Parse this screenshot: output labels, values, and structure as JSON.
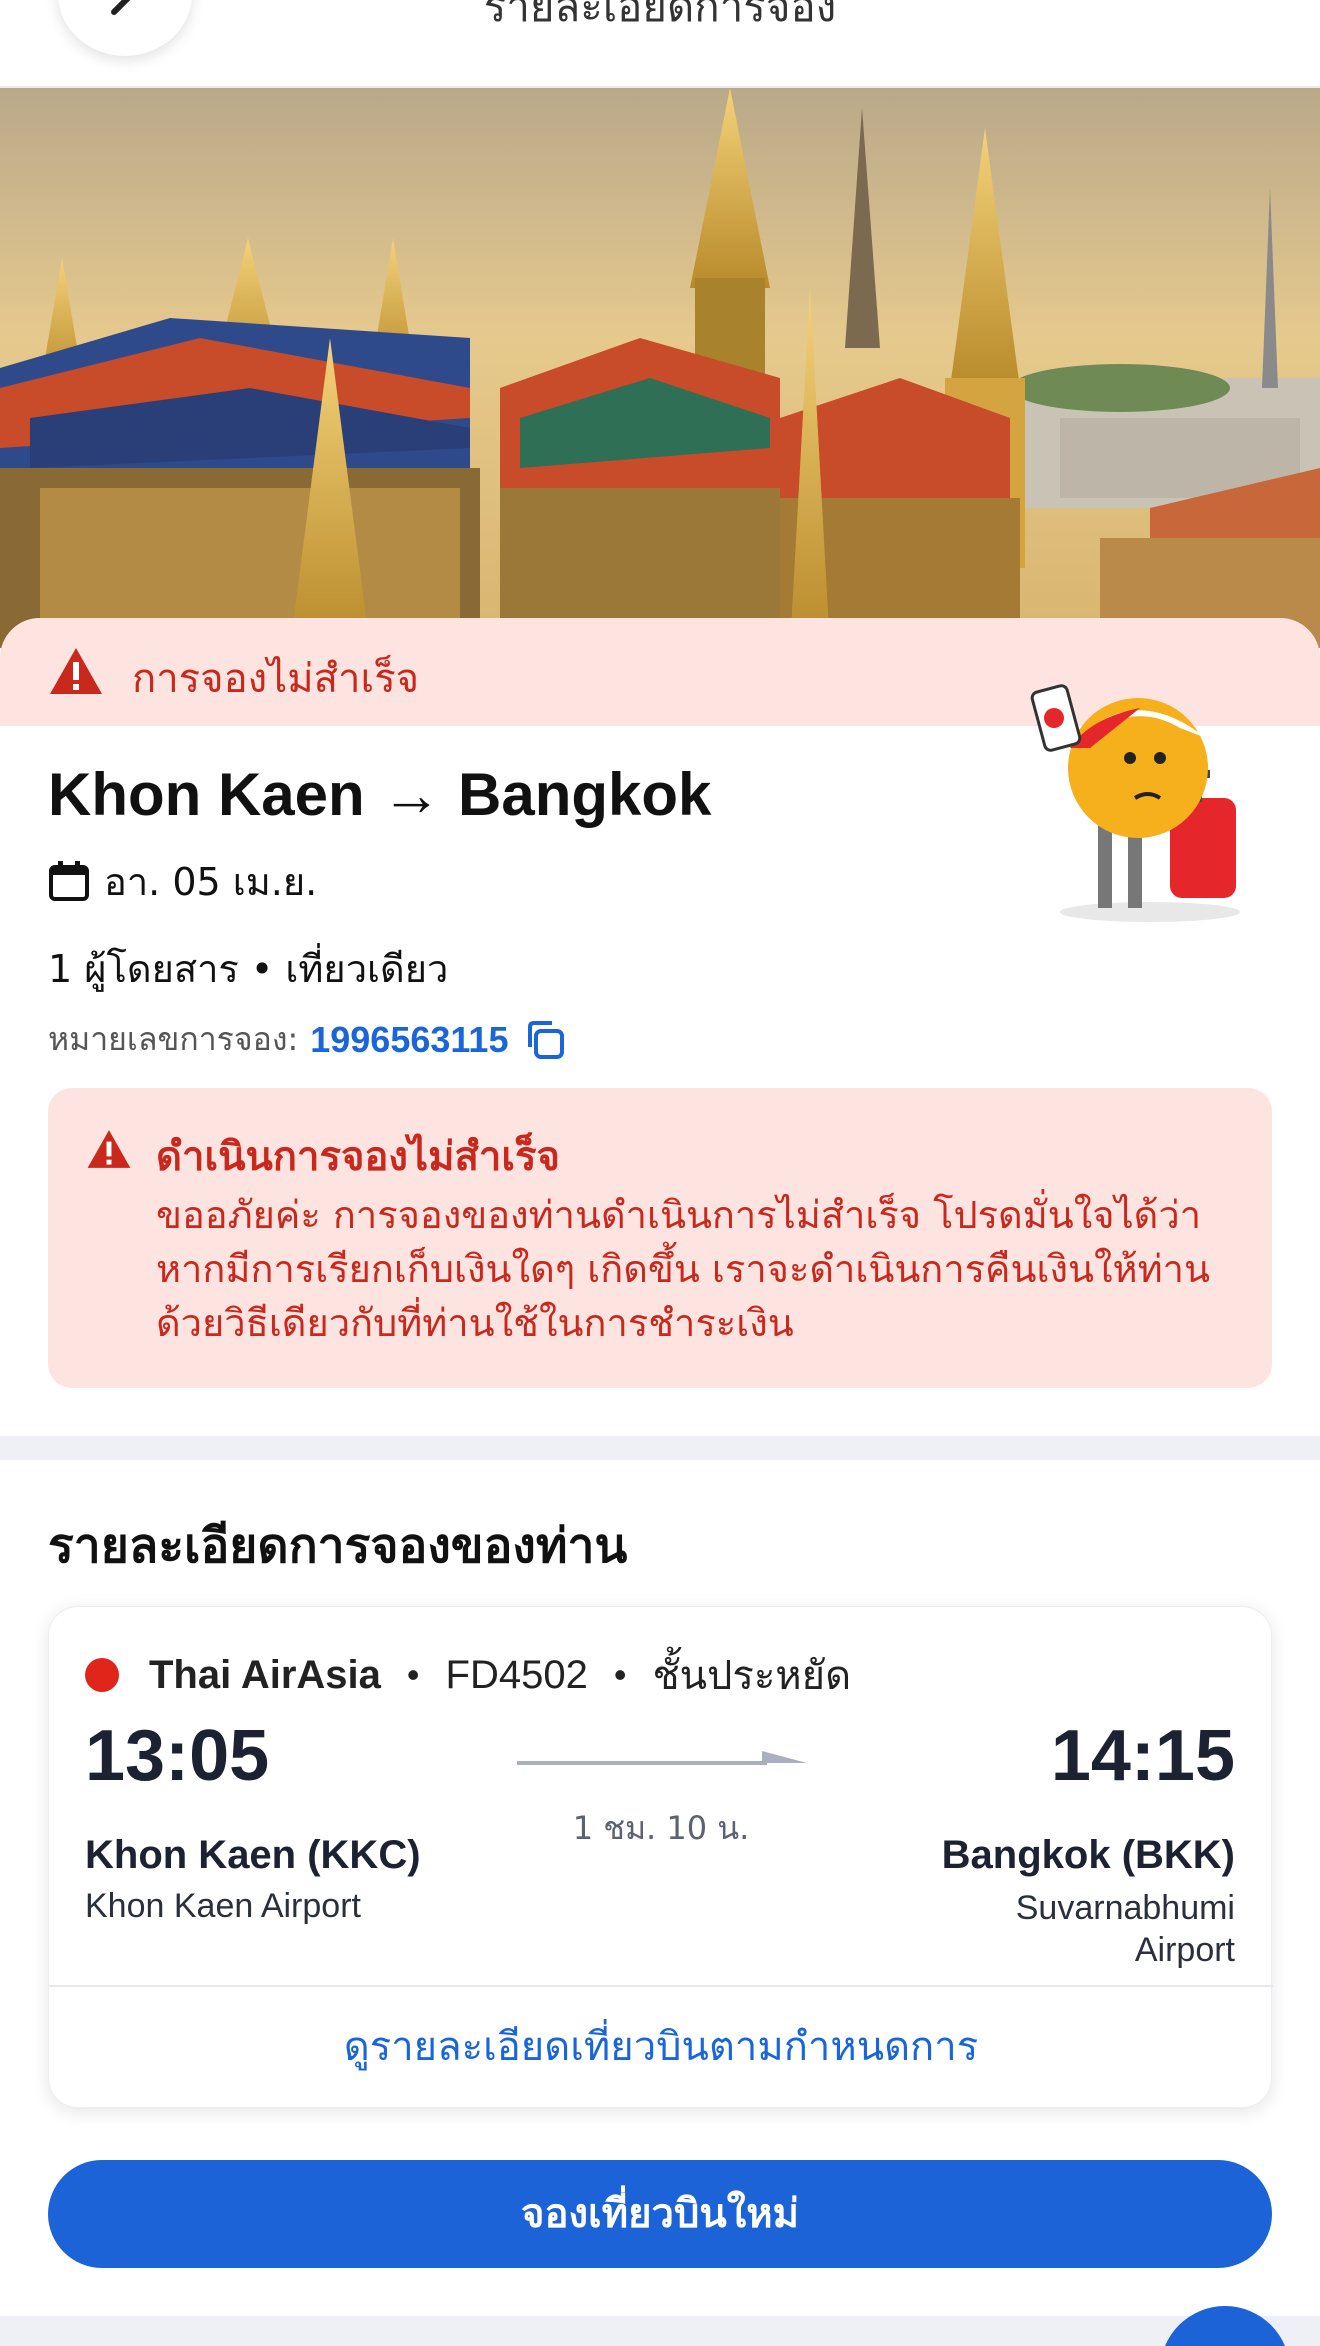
{
  "header": {
    "title": "รายละเอียดการจอง",
    "back_icon": "chevron-left-icon"
  },
  "status": {
    "label": "การจองไม่สำเร็จ",
    "icon": "warning-icon",
    "color": "#c9281d",
    "background": "#fde4e1"
  },
  "trip": {
    "route": "Khon Kaen → Bangkok",
    "date": "อา. 05 เม.ย.",
    "passengers": "1 ผู้โดยสาร • เที่ยวเดียว",
    "booking_label": "หมายเลขการจอง:",
    "booking_number": "1996563115"
  },
  "alert": {
    "title": "ดำเนินการจองไม่สำเร็จ",
    "body": "ขออภัยค่ะ การจองของท่านดำเนินการไม่สำเร็จ โปรดมั่นใจได้ว่าหากมีการเรียกเก็บเงินใดๆ เกิดขึ้น เราจะดำเนินการคืนเงินให้ท่านด้วยวิธีเดียวกับที่ท่านใช้ในการชำระเงิน"
  },
  "details": {
    "section_title": "รายละเอียดการจองของท่าน",
    "airline": "Thai AirAsia",
    "flight_number": "FD4502",
    "cabin": "ชั้นประหยัด",
    "departure_time": "13:05",
    "arrival_time": "14:15",
    "duration": "1 ชม. 10 น.",
    "departure_city": "Khon Kaen (KKC)",
    "departure_airport": "Khon Kaen Airport",
    "arrival_city": "Bangkok (BKK)",
    "arrival_airport": "Suvarnabhumi Airport",
    "view_details_label": "ดูรายละเอียดเที่ยวบินตามกำหนดการ"
  },
  "actions": {
    "rebook_label": "จองเที่ยวบินใหม่"
  },
  "colors": {
    "primary": "#1b63d6",
    "link": "#1a66d9",
    "error": "#c9281d"
  }
}
